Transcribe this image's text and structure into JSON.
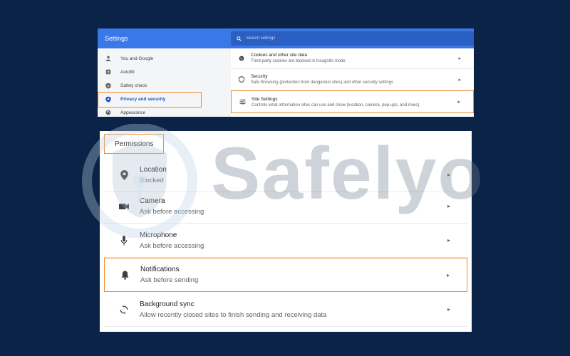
{
  "top": {
    "title": "Settings",
    "search_placeholder": "Search settings",
    "sidebar": [
      {
        "label": "You and Google",
        "icon": "person-icon"
      },
      {
        "label": "Autofill",
        "icon": "autofill-icon"
      },
      {
        "label": "Safety check",
        "icon": "shield-check-icon"
      },
      {
        "label": "Privacy and security",
        "icon": "shield-icon"
      },
      {
        "label": "Appearance",
        "icon": "palette-icon"
      }
    ],
    "rows": [
      {
        "title": "Cookies and other site data",
        "subtitle": "Third-party cookies are blocked in Incognito mode",
        "icon": "cookie-icon"
      },
      {
        "title": "Security",
        "subtitle": "Safe Browsing (protection from dangerous sites) and other security settings",
        "icon": "security-shield-icon"
      },
      {
        "title": "Site Settings",
        "subtitle": "Controls what information sites can use and show (location, camera, pop-ups, and more)",
        "icon": "sliders-icon"
      }
    ]
  },
  "bottom": {
    "header": "Permissions",
    "rows": [
      {
        "title": "Location",
        "subtitle": "Blocked",
        "icon": "location-pin-icon"
      },
      {
        "title": "Camera",
        "subtitle": "Ask before accessing",
        "icon": "camera-icon"
      },
      {
        "title": "Microphone",
        "subtitle": "Ask before accessing",
        "icon": "microphone-icon"
      },
      {
        "title": "Notifications",
        "subtitle": "Ask before sending",
        "icon": "bell-icon"
      },
      {
        "title": "Background sync",
        "subtitle": "Allow recently closed sites to finish sending and receiving data",
        "icon": "sync-icon"
      }
    ]
  },
  "watermark": {
    "text": "Safelyo"
  },
  "colors": {
    "background": "#0b2347",
    "header_blue": "#3b78e7",
    "highlight_orange": "#f28c28",
    "active_blue": "#1a56c7"
  }
}
